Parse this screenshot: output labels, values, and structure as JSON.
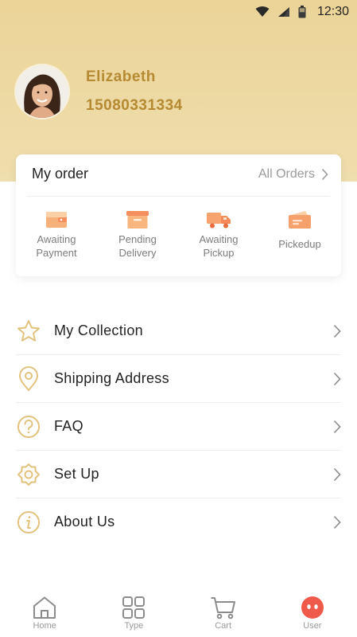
{
  "status_bar": {
    "time": "12:30"
  },
  "profile": {
    "name": "Elizabeth",
    "phone": "15080331334"
  },
  "order": {
    "title": "My order",
    "all_orders": "All Orders",
    "items": [
      {
        "line1": "Awaiting",
        "line2": "Payment",
        "icon": "wallet-icon"
      },
      {
        "line1": "Pending",
        "line2": "Delivery",
        "icon": "box-icon"
      },
      {
        "line1": "Awaiting",
        "line2": "Pickup",
        "icon": "truck-icon"
      },
      {
        "line1": "Pickedup",
        "line2": "",
        "icon": "envelope-icon"
      }
    ]
  },
  "menu": [
    {
      "label": "My Collection",
      "icon": "star-icon"
    },
    {
      "label": "Shipping Address",
      "icon": "location-pin-icon"
    },
    {
      "label": "FAQ",
      "icon": "question-icon"
    },
    {
      "label": "Set Up",
      "icon": "gear-icon"
    },
    {
      "label": "About Us",
      "icon": "info-icon"
    }
  ],
  "tabs": [
    {
      "label": "Home",
      "icon": "home-icon"
    },
    {
      "label": "Type",
      "icon": "grid-icon"
    },
    {
      "label": "Cart",
      "icon": "cart-icon"
    },
    {
      "label": "User",
      "icon": "user-face-icon"
    }
  ],
  "colors": {
    "header_gradient_top": "#ecd498",
    "accent_gold": "#b58a32",
    "icon_gold": "#e3c27e",
    "order_icon_orange": "#f5a06a",
    "user_tab_red": "#f05a4a"
  }
}
